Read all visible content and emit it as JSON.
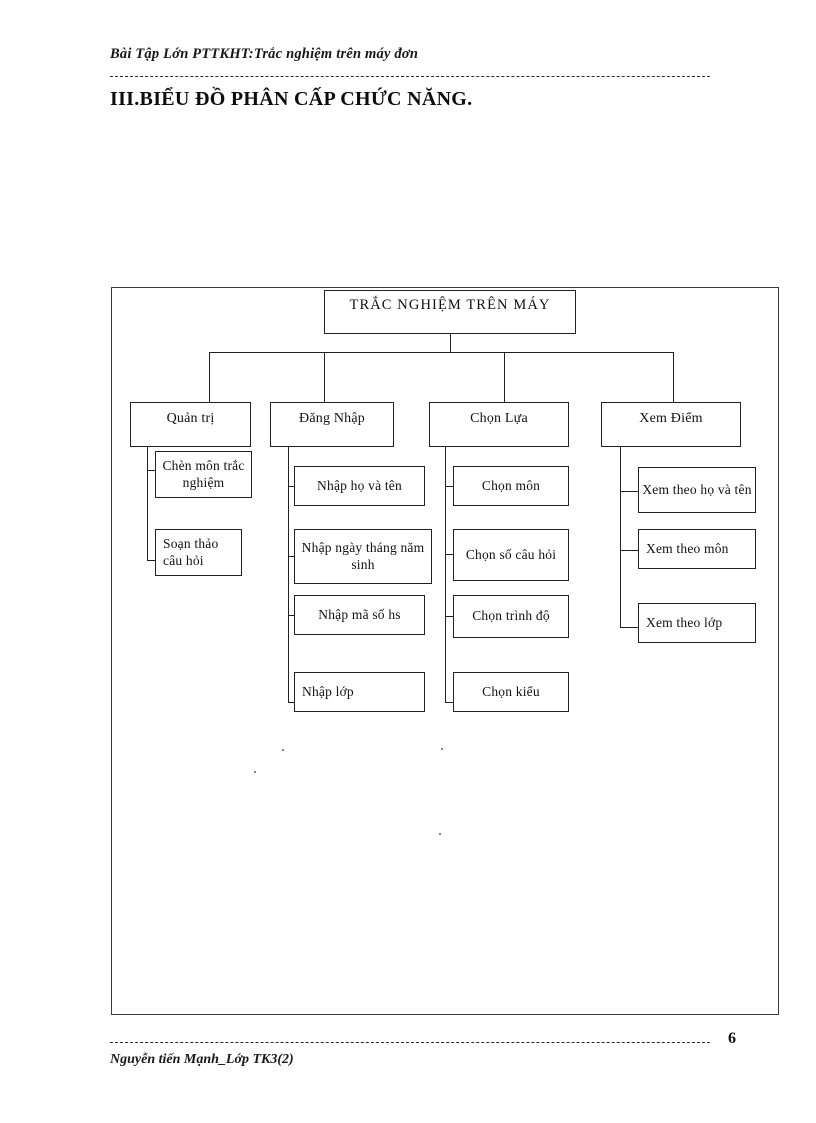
{
  "document": {
    "header": "Bài Tập Lớn PTTKHT:Trắc  nghiệm trên máy đơn",
    "section_title": "III.BIỂU ĐỒ PHÂN CẤP CHỨC NĂNG.",
    "footer": "Nguyễn tiến Mạnh_Lớp TK3(2)",
    "page_number": "6"
  },
  "diagram": {
    "type": "functional-decomposition-tree",
    "root": {
      "label": "TRẮC NGHIỆM TRÊN MÁY"
    },
    "branches": [
      {
        "label": "Quản trị",
        "children": [
          {
            "label": "Chèn môn trắc nghiệm"
          },
          {
            "label": "Soạn thảo câu hỏi"
          }
        ]
      },
      {
        "label": "Đăng Nhập",
        "children": [
          {
            "label": "Nhập họ và tên"
          },
          {
            "label": "Nhập ngày tháng năm sinh"
          },
          {
            "label": "Nhập mã số hs"
          },
          {
            "label": "Nhập lớp"
          }
        ]
      },
      {
        "label": "Chọn Lựa",
        "children": [
          {
            "label": "Chọn môn"
          },
          {
            "label": "Chọn  số câu  hỏi"
          },
          {
            "label": "Chọn trình độ"
          },
          {
            "label": "Chọn kiểu"
          }
        ]
      },
      {
        "label": "Xem Điểm",
        "children": [
          {
            "label": "Xem theo họ và  tên"
          },
          {
            "label": "Xem theo môn"
          },
          {
            "label": "Xem theo lớp"
          }
        ]
      }
    ]
  },
  "colors": {
    "ink": "#111111",
    "rule": "#2a2a2a",
    "box_border": "#222222",
    "frame_border": "#3b3b3b",
    "paper": "#ffffff"
  }
}
